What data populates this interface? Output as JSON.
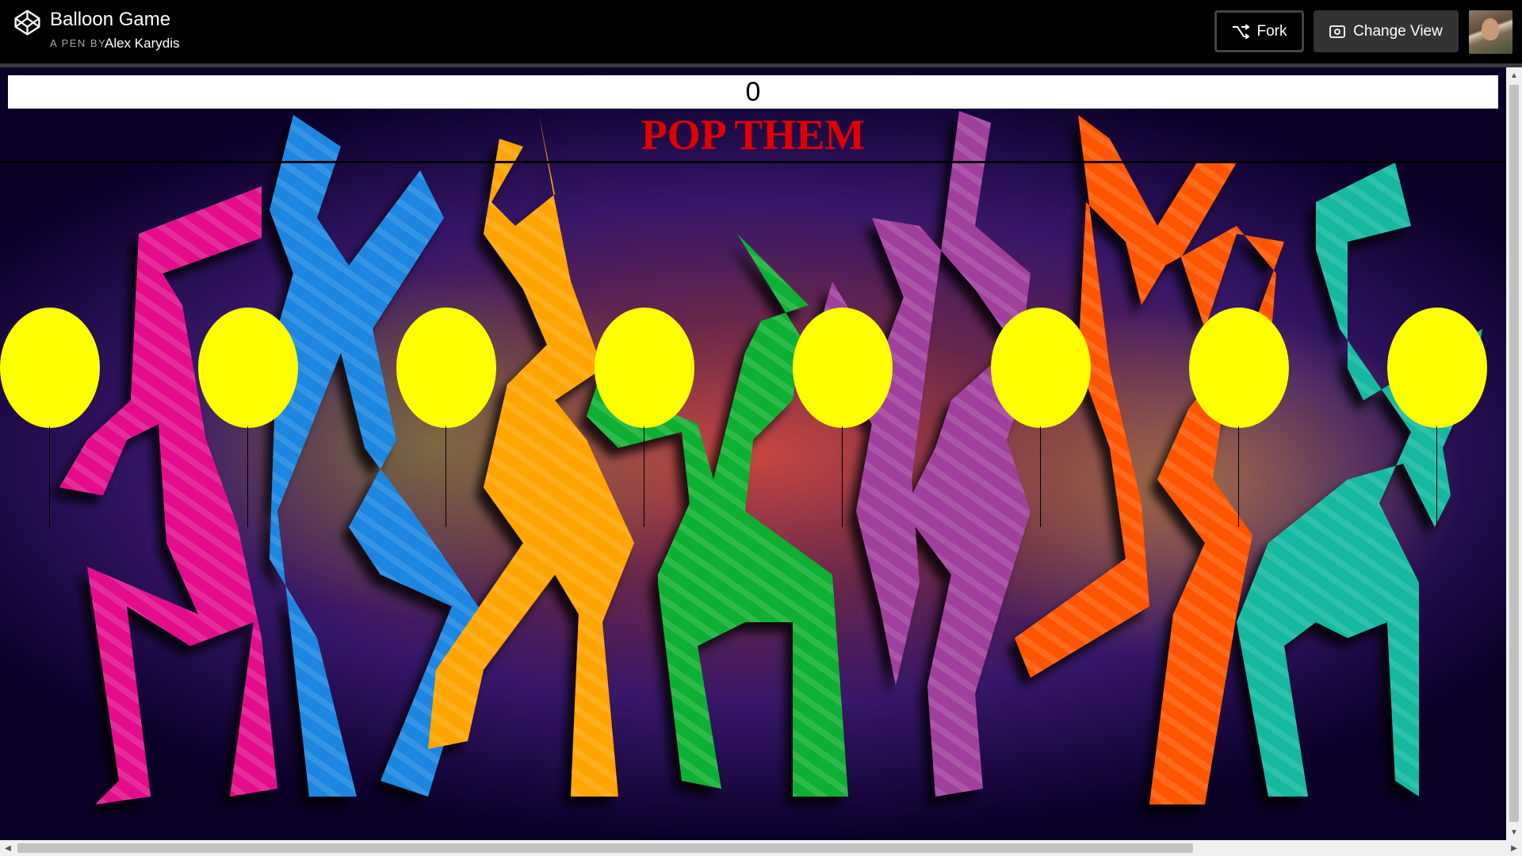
{
  "header": {
    "pen_title": "Balloon Game",
    "pen_by": "A PEN BY",
    "author": "Alex Karydis",
    "fork_label": "Fork",
    "change_view_label": "Change View"
  },
  "game": {
    "score": "0",
    "heading": "POP THEM",
    "balloon_color": "#ffff00",
    "balloon_count": 8
  },
  "colors": {
    "header_bg": "#000000",
    "heading_red": "#e00000",
    "dancer_colors": [
      "#e0108a",
      "#1e88e5",
      "#ffa000",
      "#10b030",
      "#a0409a",
      "#ff5a00",
      "#10b8a0"
    ]
  }
}
